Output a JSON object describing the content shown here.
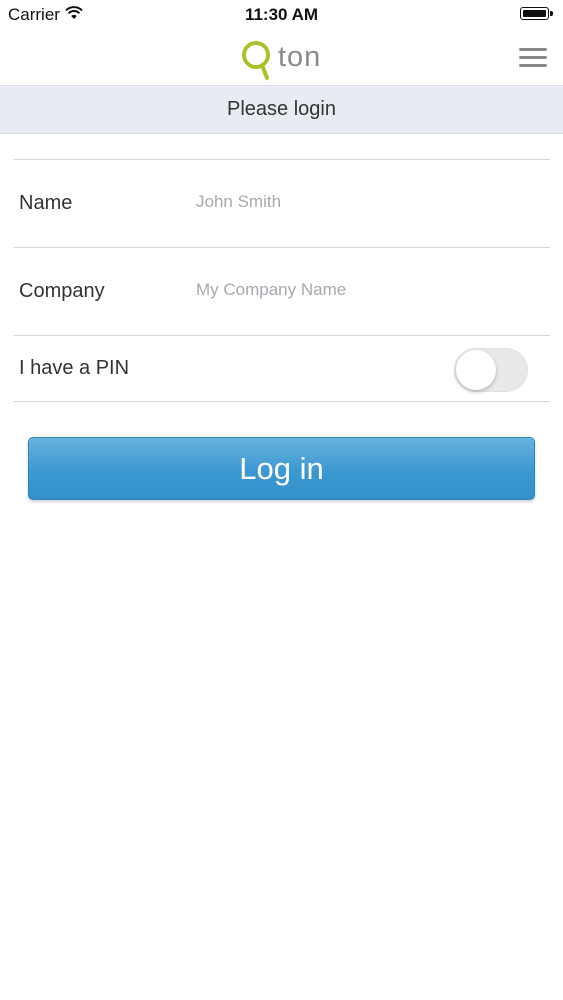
{
  "status_bar": {
    "carrier": "Carrier",
    "time": "11:30 AM",
    "wifi_icon": "wifi-icon",
    "battery_icon": "battery-icon"
  },
  "header": {
    "logo_text": "ton",
    "logo_color": "#a8c22a",
    "menu_icon": "hamburger-menu-icon"
  },
  "title": "Please login",
  "form": {
    "name": {
      "label": "Name",
      "placeholder": "John Smith",
      "value": ""
    },
    "company": {
      "label": "Company",
      "placeholder": "My Company Name",
      "value": ""
    },
    "pin": {
      "label": "I have a PIN",
      "enabled": false
    }
  },
  "login_button": {
    "label": "Log in",
    "color": "#3c98d1"
  }
}
